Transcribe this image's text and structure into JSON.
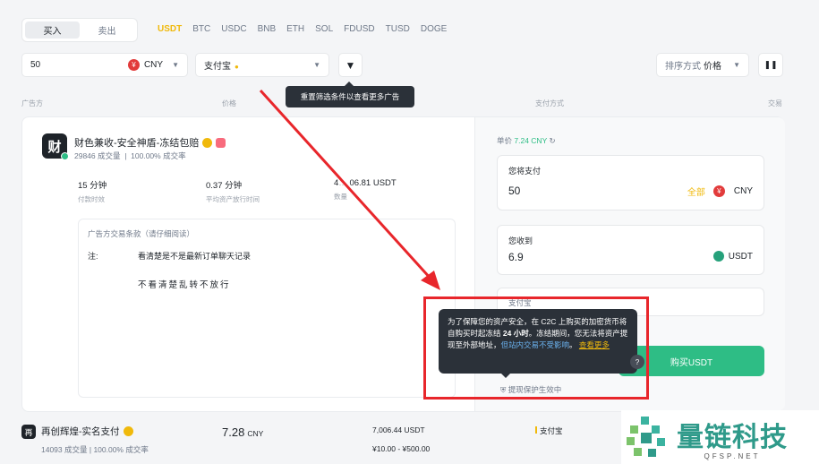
{
  "toolbar": {
    "buy_tab": "买入",
    "sell_tab": "卖出",
    "coins": [
      "USDT",
      "BTC",
      "USDC",
      "BNB",
      "ETH",
      "SOL",
      "FDUSD",
      "TUSD",
      "DOGE"
    ],
    "amount_value": "50",
    "fiat": "CNY",
    "payment_method": "支付宝",
    "filter_tooltip": "重置筛选条件以查看更多广告",
    "sort_label": "排序方式",
    "sort_value": "价格"
  },
  "columns": {
    "advertiser": "广告方",
    "price": "价格",
    "payment": "支付方式",
    "trade": "交易"
  },
  "ad": {
    "avatar_char": "财",
    "merchant_name": "财色兼收-安全神盾-冻结包赔",
    "orders": "29846 成交量",
    "completion": "100.00% 成交率",
    "pay_time_value": "15 分钟",
    "pay_time_label": "付款时效",
    "release_time_value": "0.37 分钟",
    "release_time_label": "平均资产放行时间",
    "available_value": "4",
    "available_value_tail": "06.81 USDT",
    "available_label": "数量",
    "terms_header": "广告方交易条款（请仔细阅读）",
    "note_label": "注:",
    "term_line1": "看清楚是不是最新订单聊天记录",
    "term_line2": "不看清楚乱转不放行"
  },
  "order": {
    "unit_price_label": "单价",
    "unit_price": "7.24 CNY",
    "pay_label": "您将支付",
    "pay_value": "50",
    "all_label": "全部",
    "pay_currency": "CNY",
    "receive_label": "您收到",
    "receive_value": "6.9",
    "receive_currency": "USDT",
    "payment_field": "支付宝",
    "buy_button": "购买USDT",
    "protection": "提现保护生效中",
    "tooltip_part1": "为了保障您的资产安全，在 C2C 上购买的加密货币将自购买时起冻结 ",
    "tooltip_bold": "24 小时",
    "tooltip_part2": "。冻结期间，您无法将资产提现至外部地址，",
    "tooltip_highlight": "但站内交易不受影响",
    "tooltip_part3": "。",
    "tooltip_more": "查看更多"
  },
  "ad2": {
    "avatar_char": "再",
    "merchant_name": "再创辉煌-实名支付",
    "orders": "14093 成交量",
    "completion": "100.00% 成交率",
    "price": "7.28",
    "price_currency": "CNY",
    "available": "7,006.44 USDT",
    "limit": "¥10.00 - ¥500.00",
    "payment": "支付宝"
  },
  "watermark": {
    "cn": "量链科技",
    "en": "QFSP.NET"
  },
  "colors": {
    "accent": "#f0b90b",
    "buy_green": "#2ebd85",
    "annotation_red": "#e8262b"
  }
}
